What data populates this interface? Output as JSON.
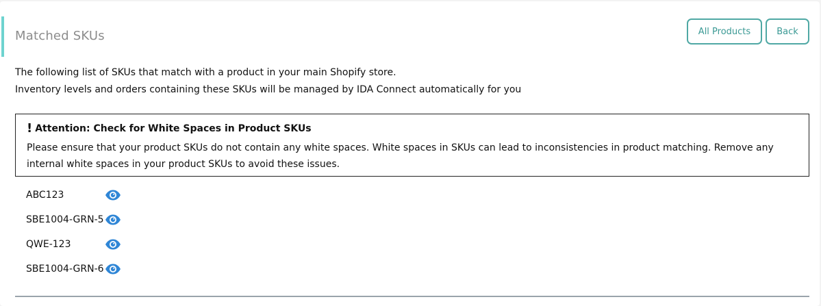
{
  "header": {
    "title": "Matched SKUs",
    "all_products_label": "All Products",
    "back_label": "Back"
  },
  "description": {
    "line1": "The following list of SKUs that match with a product in your main Shopify store.",
    "line2": "Inventory levels and orders containing these SKUs will be managed by IDA Connect automatically for you"
  },
  "alert": {
    "icon": "!",
    "title": "Attention: Check for White Spaces in Product SKUs",
    "body": "Please ensure that your product SKUs do not contain any white spaces. White spaces in SKUs can lead to inconsistencies in product matching. Remove any internal white spaces in your product SKUs to avoid these issues."
  },
  "skus": [
    {
      "sku": "ABC123",
      "icon": "eye-icon"
    },
    {
      "sku": "SBE1004-GRN-5",
      "icon": "eye-icon"
    },
    {
      "sku": "QWE-123",
      "icon": "eye-icon"
    },
    {
      "sku": "SBE1004-GRN-6",
      "icon": "eye-icon"
    }
  ],
  "colors": {
    "accent": "#6ed3cf",
    "button": "#3a9994",
    "eye": "#2f86d6"
  }
}
